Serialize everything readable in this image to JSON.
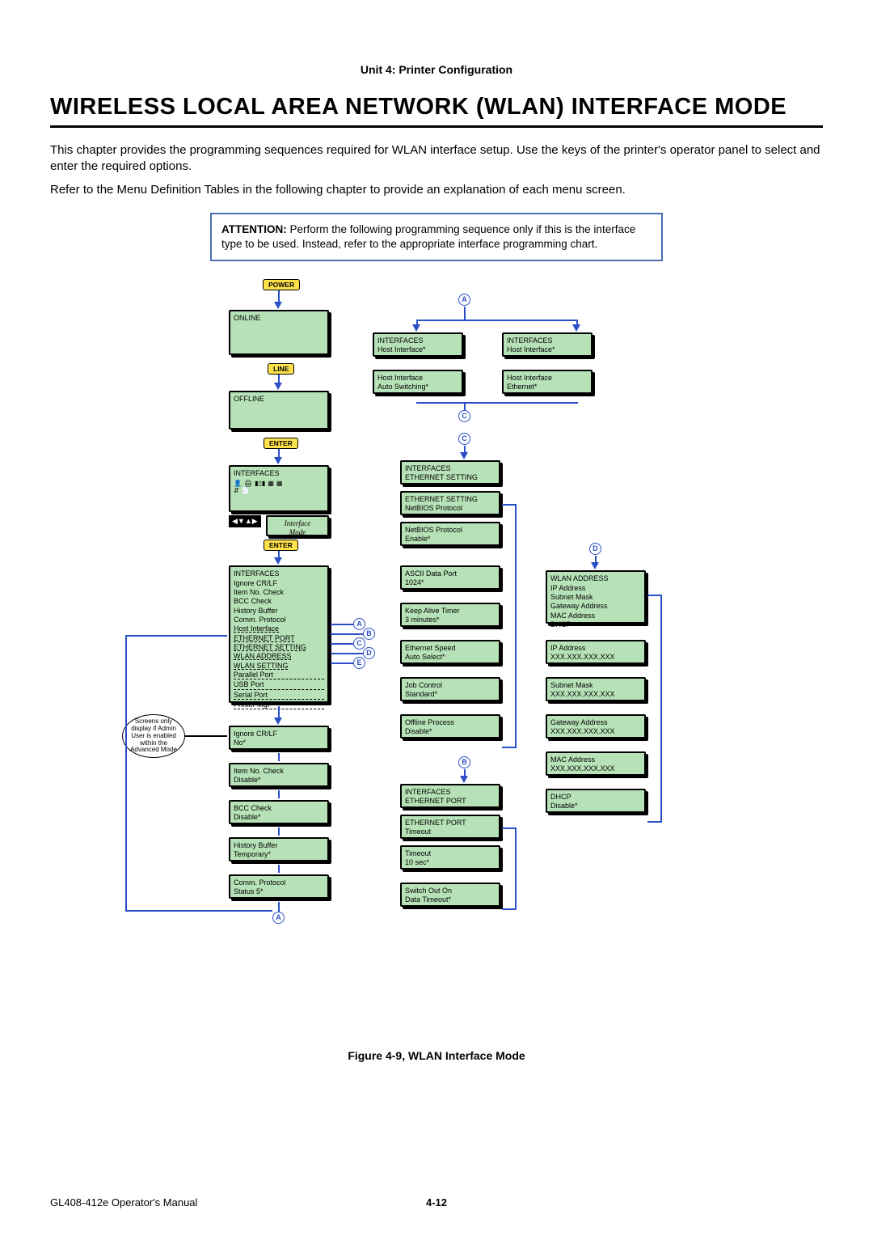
{
  "header": {
    "unit": "Unit 4: Printer Configuration"
  },
  "title": "WIRELESS LOCAL AREA NETWORK (WLAN) INTERFACE MODE",
  "para1": "This chapter provides the programming sequences required for WLAN interface setup. Use the keys of the printer's operator panel to select and enter the required options.",
  "para2": "Refer to the Menu Definition Tables in the following chapter to provide an explanation of each menu screen.",
  "attention": {
    "lead": "ATTENTION:",
    "text": " Perform the following programming sequence only if this is the interface type to be used. Instead, refer to the appropriate interface programming chart."
  },
  "buttons": {
    "power": "POWER",
    "line": "LINE",
    "enter": "ENTER"
  },
  "states": {
    "online": "ONLINE",
    "offline": "OFFLINE",
    "interfaces": "INTERFACES",
    "interface_mode": "Interface\nMode"
  },
  "circles": {
    "a": "A",
    "b": "B",
    "c": "C",
    "d": "D",
    "e": "E"
  },
  "note_oval": "Screens only display if Admin User is enabled within the Advanced Mode",
  "col1_menu": {
    "title": "INTERFACES",
    "items": [
      "Ignore CR/LF",
      "Item No. Check",
      "BCC Check",
      "History Buffer",
      "Comm. Protocol",
      "Host Interface",
      "ETHERNET PORT",
      "ETHERNET SETTING",
      "WLAN ADDRESS",
      "WLAN SETTING",
      "Parallel Port",
      "USB Port",
      "Serial Port",
      "Printer Mgt"
    ]
  },
  "col1_sub": [
    {
      "t": "Ignore CR/LF",
      "v": "No*"
    },
    {
      "t": "Item No. Check",
      "v": "Disable*"
    },
    {
      "t": "BCC Check",
      "v": "Disable*"
    },
    {
      "t": "History Buffer",
      "v": "Temporary*"
    },
    {
      "t": "Comm. Protocol",
      "v": "Status 5*"
    }
  ],
  "col2_top": [
    {
      "t": "INTERFACES",
      "v": "Host Interface*"
    },
    {
      "t": "Host Interface",
      "v": "Auto Switching*"
    }
  ],
  "col2_topR": [
    {
      "t": "INTERFACES",
      "v": "Host Interface*"
    },
    {
      "t": "Host Interface",
      "v": "Ethernet*"
    }
  ],
  "col2_c": [
    {
      "t": "INTERFACES",
      "v": "ETHERNET SETTING"
    },
    {
      "t": "ETHERNET SETTING",
      "v": "NetBIOS Protocol"
    },
    {
      "t": "NetBIOS Protocol",
      "v": "Enable*"
    },
    {
      "t": "ASCII Data Port",
      "v": "1024*"
    },
    {
      "t": "Keep Alive Timer",
      "v": "3 minutes*"
    },
    {
      "t": "Ethernet Speed",
      "v": "Auto Select*"
    },
    {
      "t": "Job Control",
      "v": "Standard*"
    },
    {
      "t": "Offline Process",
      "v": "Disable*"
    }
  ],
  "col2_b": [
    {
      "t": "INTERFACES",
      "v": "ETHERNET PORT"
    },
    {
      "t": "ETHERNET PORT",
      "v": "Timeout"
    },
    {
      "t": "Timeout",
      "v": "10  sec*"
    },
    {
      "t": "Switch Out On",
      "v": "Data Timeout*"
    }
  ],
  "col3_d_head": {
    "t": "WLAN ADDRESS",
    "items": [
      "IP Address",
      "Subnet Mask",
      "Gateway Address",
      "MAC Address",
      "DHCP"
    ]
  },
  "col3_d": [
    {
      "t": "IP Address",
      "v": "XXX.XXX.XXX.XXX"
    },
    {
      "t": "Subnet Mask",
      "v": "XXX.XXX.XXX.XXX"
    },
    {
      "t": "Gateway Address",
      "v": "XXX.XXX.XXX.XXX"
    },
    {
      "t": "MAC Address",
      "v": "XXX.XXX.XXX.XXX"
    },
    {
      "t": "DHCP",
      "v": "Disable*"
    }
  ],
  "figure_caption": "Figure 4-9, WLAN Interface Mode",
  "footer": {
    "left": "GL408-412e Operator's Manual",
    "center": "4-12"
  }
}
